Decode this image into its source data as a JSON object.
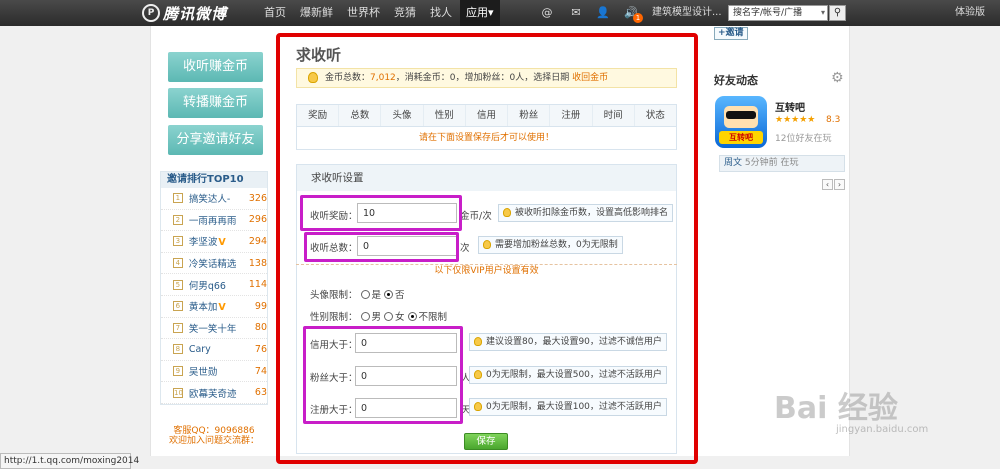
{
  "topbar": {
    "logo_text": "腾讯微博",
    "nav": [
      "首页",
      "爆新鲜",
      "世界杯",
      "竞猜",
      "找人",
      "应用"
    ],
    "nav_active_suffix": "▾",
    "icons": [
      "@",
      "✉",
      "👤",
      "🔊"
    ],
    "badge": "1",
    "user": "建筑模型设计...",
    "search_value": "搜名字/帐号/广播",
    "search_drop": "▾",
    "right_link": "体验版"
  },
  "sidebar": {
    "buttons": [
      "收听赚金币",
      "转播赚金币",
      "分享邀请好友"
    ],
    "rank_title": "邀请排行TOP10",
    "rank": [
      {
        "n": "1",
        "name": "搞笑达人-",
        "v": false,
        "score": "326"
      },
      {
        "n": "2",
        "name": "一雨再再雨",
        "v": false,
        "score": "296"
      },
      {
        "n": "3",
        "name": "李坚波",
        "v": true,
        "score": "294"
      },
      {
        "n": "4",
        "name": "冷笑话精选",
        "v": false,
        "score": "138"
      },
      {
        "n": "5",
        "name": "何男q66",
        "v": false,
        "score": "114"
      },
      {
        "n": "6",
        "name": "黄本加",
        "v": true,
        "score": "99"
      },
      {
        "n": "7",
        "name": "笑一笑十年",
        "v": false,
        "score": "80"
      },
      {
        "n": "8",
        "name": "Cary",
        "v": false,
        "score": "76"
      },
      {
        "n": "9",
        "name": "吴世勋",
        "v": false,
        "score": "74"
      },
      {
        "n": "10",
        "name": "欧幕芙奇迹",
        "v": false,
        "score": "63"
      }
    ],
    "v_mark": "V",
    "service_qq": "客服QQ：9096886",
    "service_group": "欢迎加入问题交流群："
  },
  "main": {
    "title": "求收听",
    "info": {
      "label_coins": "金币总数：",
      "coins": "7,012",
      "label_spent": "，消耗金币：",
      "spent": "0",
      "label_fans": "，增加粉丝：",
      "fans": "0人",
      "label_date": "，选择日期",
      "link": "收回金币"
    },
    "table_headers": [
      "奖励",
      "总数",
      "头像",
      "性别",
      "信用",
      "粉丝",
      "注册",
      "时间",
      "状态"
    ],
    "table_note": "请在下面设置保存后才可以使用！",
    "settings_title": "求收听设置",
    "reward": {
      "label": "收听奖励：",
      "value": "10",
      "unit": "金币/次",
      "tip": "被收听扣除金币数，设置高低影响排名"
    },
    "total": {
      "label": "收听总数：",
      "value": "0",
      "unit": "次",
      "tip": "需要增加粉丝总数，0为无限制"
    },
    "vip_note": "以下仅限VIP用户设置有效",
    "avatar_limit": {
      "label": "头像限制：",
      "options": [
        "是",
        "否"
      ],
      "selected": "否"
    },
    "gender_limit": {
      "label": "性别限制：",
      "options": [
        "男",
        "女",
        "不限制"
      ],
      "selected": "不限制"
    },
    "credit": {
      "label": "信用大于：",
      "value": "0",
      "tip": "建议设置80，最大设置90，过滤不诚信用户"
    },
    "fans": {
      "label": "粉丝大于：",
      "value": "0",
      "unit": "人",
      "tip": "0为无限制，最大设置500，过滤不活跃用户"
    },
    "register": {
      "label": "注册大于：",
      "value": "0",
      "unit": "天",
      "tip": "0为无限制，最大设置100，过滤不活跃用户"
    },
    "save": "保存"
  },
  "right": {
    "invite": "+邀请",
    "friends_title": "好友动态",
    "app_icon_label": "互转吧",
    "app_name": "互转吧",
    "stars": "★★★★★",
    "rating": "8.3",
    "app_sub": "12位好友在玩",
    "activity_who": "周文",
    "activity_text": " 5分钟前 在玩",
    "pager": [
      "‹",
      "›"
    ]
  },
  "statusbar": "http://1.t.qq.com/moxing2014",
  "watermark": {
    "main": "Bai 经验",
    "sub": "jingyan.baidu.com"
  },
  "colors": {
    "accent_red": "#e00000",
    "highlight_magenta": "#c81ec8",
    "orange": "#e07000",
    "teal_button": "#5cb8b3",
    "save_green": "#4aa62e"
  }
}
